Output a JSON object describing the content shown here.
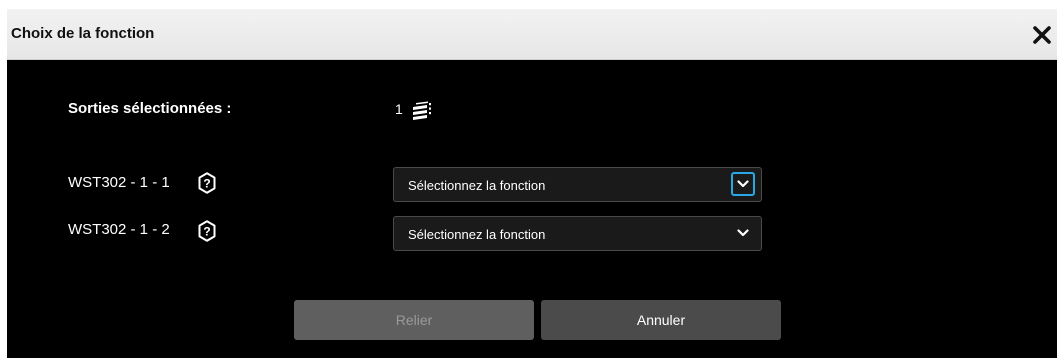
{
  "dialog": {
    "title": "Choix de la fonction",
    "close_icon": "close-icon"
  },
  "selection": {
    "label": "Sorties sélectionnées :",
    "count": "1",
    "icon": "stack-icon"
  },
  "outputs": [
    {
      "label": "WST302 - 1 - 1",
      "select_value": "Sélectionnez la fonction",
      "focused": true
    },
    {
      "label": "WST302 - 1 - 2",
      "select_value": "Sélectionnez la fonction",
      "focused": false
    }
  ],
  "buttons": {
    "link_label": "Relier",
    "cancel_label": "Annuler"
  },
  "colors": {
    "dialog_bg": "#000000",
    "titlebar_bg": "#eeeeee",
    "focus_ring": "#2aa8e6",
    "button_disabled": "#5f5f5f",
    "button_active": "#4b4b4b"
  }
}
